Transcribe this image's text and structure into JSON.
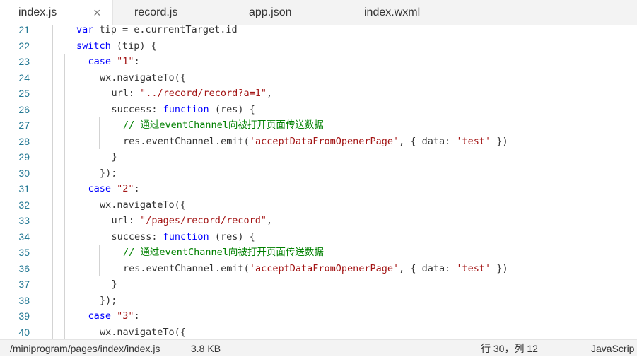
{
  "tabs": [
    {
      "label": "index.js",
      "active": true
    },
    {
      "label": "record.js",
      "active": false
    },
    {
      "label": "app.json",
      "active": false
    },
    {
      "label": "index.wxml",
      "active": false
    }
  ],
  "close_glyph": "×",
  "editor": {
    "lines": [
      {
        "n": "21",
        "indent": 1,
        "tokens": [
          {
            "t": "var",
            "c": "kw"
          },
          {
            "t": " tip = e.currentTarget.id",
            "c": ""
          }
        ]
      },
      {
        "n": "22",
        "indent": 1,
        "tokens": [
          {
            "t": "switch",
            "c": "kw"
          },
          {
            "t": " (tip) {",
            "c": ""
          }
        ]
      },
      {
        "n": "23",
        "indent": 2,
        "tokens": [
          {
            "t": "case",
            "c": "kw"
          },
          {
            "t": " ",
            "c": ""
          },
          {
            "t": "\"1\"",
            "c": "str"
          },
          {
            "t": ":",
            "c": ""
          }
        ]
      },
      {
        "n": "24",
        "indent": 3,
        "tokens": [
          {
            "t": "wx.navigateTo({",
            "c": ""
          }
        ]
      },
      {
        "n": "25",
        "indent": 4,
        "tokens": [
          {
            "t": "url: ",
            "c": ""
          },
          {
            "t": "\"../record/record?a=1\"",
            "c": "str"
          },
          {
            "t": ",",
            "c": ""
          }
        ]
      },
      {
        "n": "26",
        "indent": 4,
        "tokens": [
          {
            "t": "success: ",
            "c": ""
          },
          {
            "t": "function",
            "c": "kw"
          },
          {
            "t": " (res) {",
            "c": ""
          }
        ]
      },
      {
        "n": "27",
        "indent": 5,
        "tokens": [
          {
            "t": "// 通过eventChannel向被打开页面传送数据",
            "c": "cmt"
          }
        ]
      },
      {
        "n": "28",
        "indent": 5,
        "tokens": [
          {
            "t": "res.eventChannel.emit(",
            "c": ""
          },
          {
            "t": "'acceptDataFromOpenerPage'",
            "c": "str"
          },
          {
            "t": ", { data: ",
            "c": ""
          },
          {
            "t": "'test'",
            "c": "str"
          },
          {
            "t": " })",
            "c": ""
          }
        ]
      },
      {
        "n": "29",
        "indent": 4,
        "tokens": [
          {
            "t": "}",
            "c": ""
          }
        ]
      },
      {
        "n": "30",
        "indent": 3,
        "tokens": [
          {
            "t": "});",
            "c": ""
          }
        ]
      },
      {
        "n": "31",
        "indent": 2,
        "tokens": [
          {
            "t": "case",
            "c": "kw"
          },
          {
            "t": " ",
            "c": ""
          },
          {
            "t": "\"2\"",
            "c": "str"
          },
          {
            "t": ":",
            "c": ""
          }
        ]
      },
      {
        "n": "32",
        "indent": 3,
        "tokens": [
          {
            "t": "wx.navigateTo({",
            "c": ""
          }
        ]
      },
      {
        "n": "33",
        "indent": 4,
        "tokens": [
          {
            "t": "url: ",
            "c": ""
          },
          {
            "t": "\"/pages/record/record\"",
            "c": "str"
          },
          {
            "t": ",",
            "c": ""
          }
        ]
      },
      {
        "n": "34",
        "indent": 4,
        "tokens": [
          {
            "t": "success: ",
            "c": ""
          },
          {
            "t": "function",
            "c": "kw"
          },
          {
            "t": " (res) {",
            "c": ""
          }
        ]
      },
      {
        "n": "35",
        "indent": 5,
        "tokens": [
          {
            "t": "// 通过eventChannel向被打开页面传送数据",
            "c": "cmt"
          }
        ]
      },
      {
        "n": "36",
        "indent": 5,
        "tokens": [
          {
            "t": "res.eventChannel.emit(",
            "c": ""
          },
          {
            "t": "'acceptDataFromOpenerPage'",
            "c": "str"
          },
          {
            "t": ", { data: ",
            "c": ""
          },
          {
            "t": "'test'",
            "c": "str"
          },
          {
            "t": " })",
            "c": ""
          }
        ]
      },
      {
        "n": "37",
        "indent": 4,
        "tokens": [
          {
            "t": "}",
            "c": ""
          }
        ]
      },
      {
        "n": "38",
        "indent": 3,
        "tokens": [
          {
            "t": "});",
            "c": ""
          }
        ]
      },
      {
        "n": "39",
        "indent": 2,
        "tokens": [
          {
            "t": "case",
            "c": "kw"
          },
          {
            "t": " ",
            "c": ""
          },
          {
            "t": "\"3\"",
            "c": "str"
          },
          {
            "t": ":",
            "c": ""
          }
        ]
      },
      {
        "n": "40",
        "indent": 3,
        "tokens": [
          {
            "t": "wx.navigateTo({",
            "c": ""
          }
        ]
      }
    ]
  },
  "statusbar": {
    "path": "/miniprogram/pages/index/index.js",
    "size": "3.8 KB",
    "cursor": "行 30，列 12",
    "language": "JavaScrip"
  }
}
